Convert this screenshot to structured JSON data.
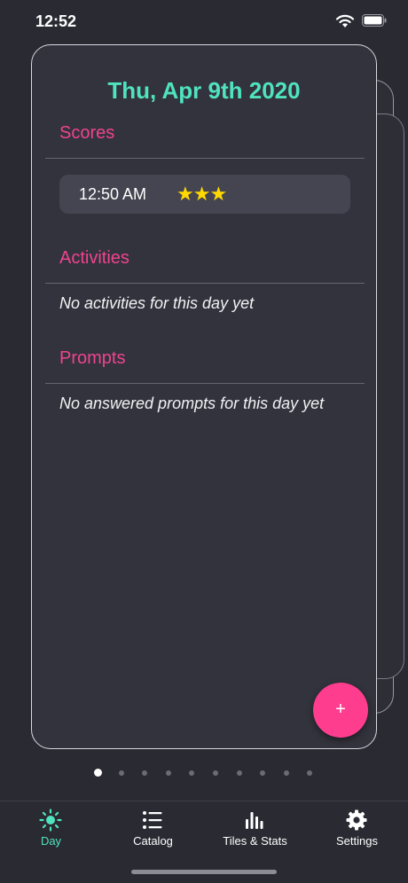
{
  "status_bar": {
    "time": "12:52"
  },
  "card": {
    "date": "Thu, Apr 9th 2020",
    "sections": {
      "scores": {
        "title": "Scores",
        "entries": [
          {
            "time": "12:50 AM",
            "stars": "★★★",
            "rating": 3
          }
        ]
      },
      "activities": {
        "title": "Activities",
        "empty_text": "No activities for this day yet"
      },
      "prompts": {
        "title": "Prompts",
        "empty_text": "No answered prompts for this day yet"
      }
    },
    "fab_label": "+"
  },
  "pagination": {
    "total": 10,
    "current": 1
  },
  "tab_bar": {
    "tabs": [
      {
        "label": "Day",
        "icon": "sun-icon",
        "active": true
      },
      {
        "label": "Catalog",
        "icon": "list-icon",
        "active": false
      },
      {
        "label": "Tiles & Stats",
        "icon": "bar-chart-icon",
        "active": false
      },
      {
        "label": "Settings",
        "icon": "gear-icon",
        "active": false
      }
    ]
  },
  "colors": {
    "accent_teal": "#4fe3be",
    "accent_pink": "#f0438f",
    "fab": "#ff3d8f",
    "star": "#ffd800",
    "background": "#2a2a33",
    "card": "#33333d"
  }
}
